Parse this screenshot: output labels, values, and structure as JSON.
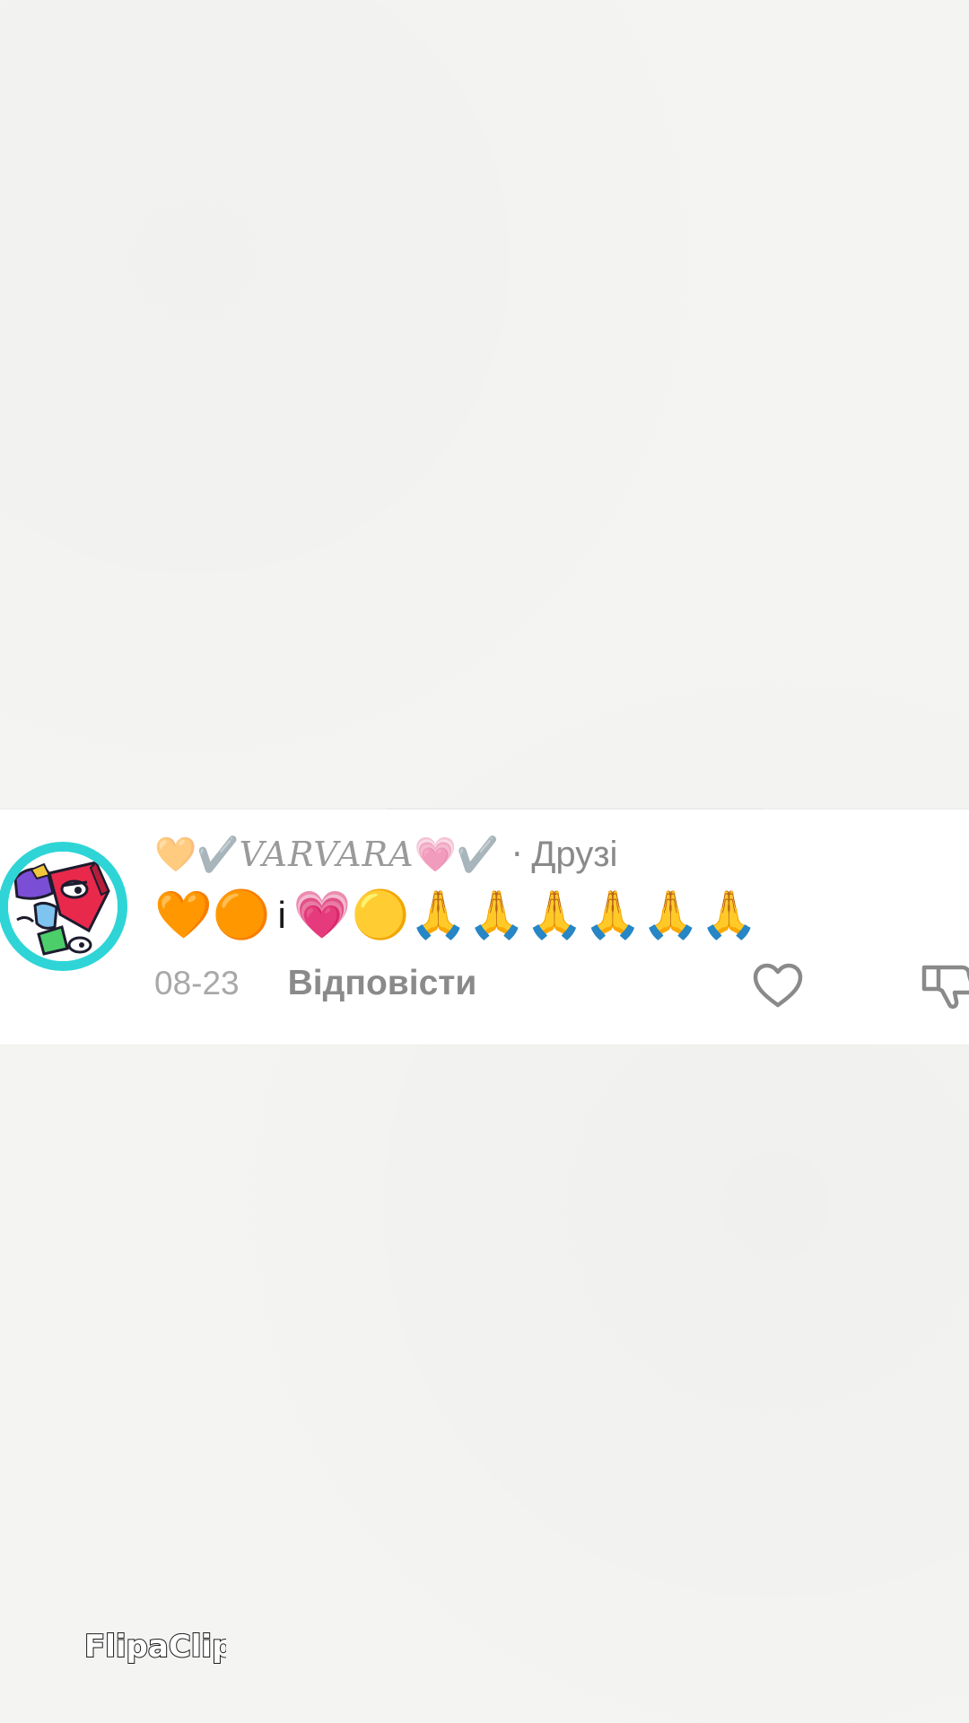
{
  "comment": {
    "username_prefix_icons": [
      "🧡",
      "✔️"
    ],
    "username": "VARVARA",
    "username_suffix_icons": [
      "💗",
      "✔️"
    ],
    "separator": "·",
    "relationship": "Друзі",
    "text_parts": [
      "🧡",
      "🟠",
      "і",
      "💗",
      "🟡",
      "🙏",
      "🙏",
      "🙏",
      "🙏",
      "🙏",
      "🙏"
    ],
    "date": "08-23",
    "reply_label": "Відповісти",
    "like_icon": "heart-outline-icon",
    "dislike_icon": "thumbs-down-icon"
  },
  "watermark": {
    "text": "FlipaClip"
  },
  "colors": {
    "avatar_ring": "#2fd5d6",
    "background": "#f4f4f2",
    "muted_text": "#8a8a8a"
  }
}
